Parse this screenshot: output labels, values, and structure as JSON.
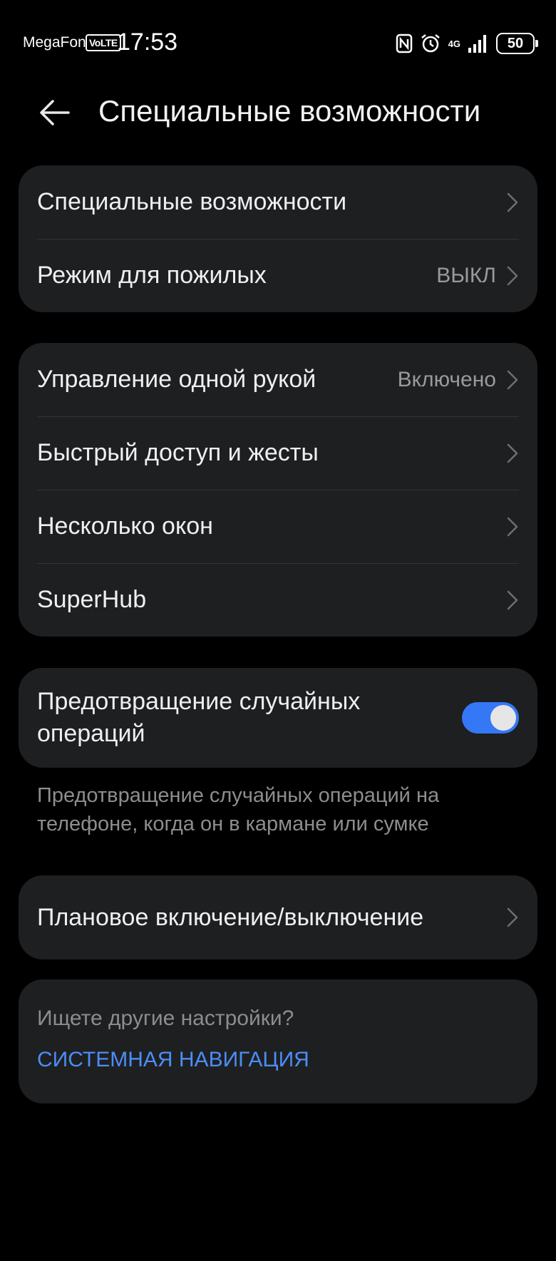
{
  "status_bar": {
    "carrier": "MegaFon",
    "volte": "VoLTE",
    "time": "17:53",
    "network": "4G",
    "battery": "50",
    "icons": [
      "nfc-icon",
      "alarm-icon",
      "signal-icon",
      "battery-icon"
    ]
  },
  "header": {
    "title": "Специальные возможности",
    "back_icon": "arrow-left-icon"
  },
  "group1": {
    "items": [
      {
        "label": "Специальные возможности",
        "value": ""
      },
      {
        "label": "Режим для пожилых",
        "value": "ВЫКЛ"
      }
    ]
  },
  "group2": {
    "items": [
      {
        "label": "Управление одной рукой",
        "value": "Включено"
      },
      {
        "label": "Быстрый доступ и жесты",
        "value": ""
      },
      {
        "label": "Несколько окон",
        "value": ""
      },
      {
        "label": "SuperHub",
        "value": ""
      }
    ]
  },
  "accidental": {
    "label": "Предотвращение случайных операций",
    "enabled": true,
    "description": "Предотвращение случайных операций на телефоне, когда он в кармане или сумке"
  },
  "schedule": {
    "label": "Плановое включение/выключение"
  },
  "search": {
    "question": "Ищете другие настройки?",
    "link": "СИСТЕМНАЯ НАВИГАЦИЯ"
  },
  "colors": {
    "background": "#000000",
    "card": "#1e1f21",
    "accent": "#3478f6",
    "link": "#4c8df6"
  }
}
